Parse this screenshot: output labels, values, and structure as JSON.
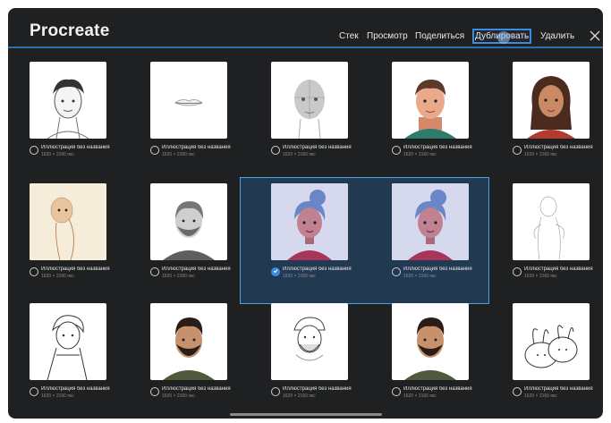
{
  "app": {
    "title": "Procreate"
  },
  "toolbar": {
    "items": [
      {
        "label": "Стек"
      },
      {
        "label": "Просмотр"
      },
      {
        "label": "Поделиться"
      },
      {
        "label": "Дублировать"
      },
      {
        "label": "Удалить"
      }
    ],
    "active_item": "Дублировать",
    "close_icon": "close-icon"
  },
  "gallery": {
    "items": [
      {
        "title": "Иллюстрация без названия",
        "size": "1620 × 2160 пкс",
        "selected": false,
        "thumb": "boy-portrait-sketch"
      },
      {
        "title": "Иллюстрация без названия",
        "size": "1620 × 2160 пкс",
        "selected": false,
        "thumb": "lips-sketch"
      },
      {
        "title": "Иллюстрация без названия",
        "size": "1620 × 2160 пкс",
        "selected": false,
        "thumb": "head-construction"
      },
      {
        "title": "Иллюстрация без названия",
        "size": "1620 × 2160 пкс",
        "selected": false,
        "thumb": "man-portrait-color"
      },
      {
        "title": "Иллюстрация без названия",
        "size": "1620 × 2160 пкс",
        "selected": false,
        "thumb": "woman-portrait-color"
      },
      {
        "title": "Иллюстрация без названия",
        "size": "1620 × 2160 пкс",
        "selected": false,
        "thumb": "bald-figure-beige"
      },
      {
        "title": "Иллюстрация без названия",
        "size": "1620 × 2160 пкс",
        "selected": false,
        "thumb": "bearded-man-grey"
      },
      {
        "title": "Иллюстрация без названия",
        "size": "1620 × 2160 пкс",
        "selected": true,
        "thumb": "bun-girl-portrait"
      },
      {
        "title": "Иллюстрация без названия",
        "size": "1620 × 2160 пкс",
        "selected": false,
        "thumb": "bun-girl-portrait"
      },
      {
        "title": "Иллюстрация без названия",
        "size": "1620 × 2160 пкс",
        "selected": false,
        "thumb": "figure-line-sketch"
      },
      {
        "title": "Иллюстрация без названия",
        "size": "1620 × 2160 пкс",
        "selected": false,
        "thumb": "boy-ink-sketch"
      },
      {
        "title": "Иллюстрация без названия",
        "size": "1620 × 2160 пкс",
        "selected": false,
        "thumb": "bearded-man-color"
      },
      {
        "title": "Иллюстрация без названия",
        "size": "1620 × 2160 пкс",
        "selected": false,
        "thumb": "cap-man-sketch"
      },
      {
        "title": "Иллюстрация без названия",
        "size": "1620 × 2160 пкс",
        "selected": false,
        "thumb": "bearded-man-color"
      },
      {
        "title": "Иллюстрация без названия",
        "size": "1620 × 2160 пкс",
        "selected": false,
        "thumb": "bunnies-sketch"
      }
    ]
  },
  "colors": {
    "background": "#1f2021",
    "accent": "#3c8be0",
    "selection_fill": "#223952"
  }
}
